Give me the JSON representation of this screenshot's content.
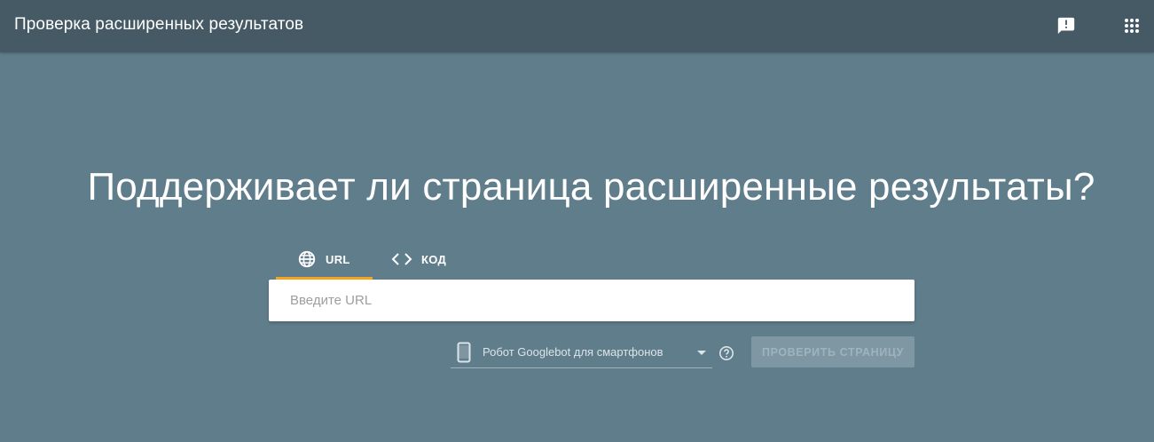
{
  "header": {
    "title": "Проверка расширенных результатов",
    "feedback_icon": "feedback-icon",
    "apps_icon": "apps-grid-icon"
  },
  "main": {
    "headline": "Поддерживает ли страница расширенные результаты?",
    "tabs": [
      {
        "label": "URL",
        "icon": "globe-icon",
        "active": true
      },
      {
        "label": "КОД",
        "icon": "code-icon",
        "active": false
      }
    ],
    "url_input": {
      "placeholder": "Введите URL",
      "value": ""
    },
    "user_agent": {
      "selected": "Робот Googlebot для смартфонов",
      "icon": "smartphone-icon"
    },
    "help_icon": "help-icon",
    "test_button_label": "ПРОВЕРИТЬ СТРАНИЦУ"
  },
  "colors": {
    "background": "#607d8b",
    "header": "#455a64",
    "tab_indicator": "#f7a51c",
    "button_disabled": "#7e97a3"
  }
}
